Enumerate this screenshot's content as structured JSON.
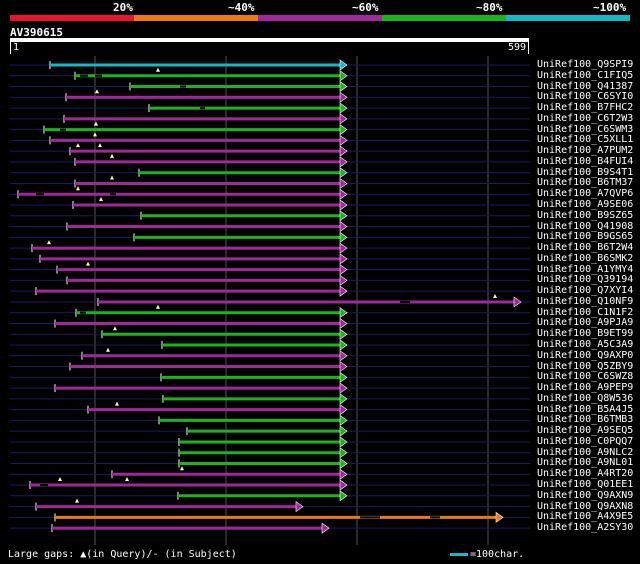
{
  "legend": {
    "segments": [
      {
        "color": "#e8142c"
      },
      {
        "color": "#f07814"
      },
      {
        "color": "#a0289c"
      },
      {
        "color": "#1cb41c"
      },
      {
        "color": "#16b8c8"
      }
    ],
    "labels": [
      "20%",
      "~40%",
      "~60%",
      "~80%",
      "~100%"
    ]
  },
  "query": {
    "name": "AV390615",
    "start": "1",
    "end": "599"
  },
  "hits": [
    {
      "name": "UniRef100_Q9SPI9",
      "color": "#16b8c8",
      "start": 50,
      "end": 347,
      "marks": [],
      "gaps": []
    },
    {
      "name": "UniRef100_C1FIQ5",
      "color": "#1cb41c",
      "start": 75,
      "end": 347,
      "marks": [
        158
      ],
      "gaps": [
        [
          80,
          88
        ],
        [
          95,
          102
        ]
      ]
    },
    {
      "name": "UniRef100_Q41387",
      "color": "#1cb41c",
      "start": 130,
      "end": 347,
      "marks": [],
      "gaps": [
        [
          180,
          186
        ]
      ]
    },
    {
      "name": "UniRef100_C6SYI0",
      "color": "#a0289c",
      "start": 66,
      "end": 347,
      "marks": [
        97
      ],
      "gaps": []
    },
    {
      "name": "UniRef100_B7FHC2",
      "color": "#1cb41c",
      "start": 149,
      "end": 347,
      "marks": [],
      "gaps": [
        [
          200,
          205
        ]
      ]
    },
    {
      "name": "UniRef100_C6T2W3",
      "color": "#a0289c",
      "start": 64,
      "end": 347,
      "marks": [],
      "gaps": []
    },
    {
      "name": "UniRef100_C6SWM3",
      "color": "#1cb41c",
      "start": 44,
      "end": 347,
      "marks": [
        96
      ],
      "gaps": [
        [
          60,
          66
        ]
      ]
    },
    {
      "name": "UniRef100_C5XLL1",
      "color": "#a0289c",
      "start": 50,
      "end": 347,
      "marks": [
        95
      ],
      "gaps": []
    },
    {
      "name": "UniRef100_A7PUM2",
      "color": "#a0289c",
      "start": 70,
      "end": 347,
      "marks": [
        78,
        100
      ],
      "gaps": []
    },
    {
      "name": "UniRef100_B4FUI4",
      "color": "#a0289c",
      "start": 75,
      "end": 347,
      "marks": [
        112
      ],
      "gaps": []
    },
    {
      "name": "UniRef100_B9S4T1",
      "color": "#1cb41c",
      "start": 139,
      "end": 347,
      "marks": [],
      "gaps": []
    },
    {
      "name": "UniRef100_B6TM37",
      "color": "#a0289c",
      "start": 75,
      "end": 347,
      "marks": [
        112
      ],
      "gaps": []
    },
    {
      "name": "UniRef100_A7QVP6",
      "color": "#a0289c",
      "start": 18,
      "end": 347,
      "marks": [
        78
      ],
      "gaps": [
        [
          36,
          44
        ],
        [
          110,
          116
        ]
      ]
    },
    {
      "name": "UniRef100_A9SE06",
      "color": "#a0289c",
      "start": 73,
      "end": 347,
      "marks": [
        101
      ],
      "gaps": []
    },
    {
      "name": "UniRef100_B9SZ65",
      "color": "#1cb41c",
      "start": 141,
      "end": 347,
      "marks": [],
      "gaps": []
    },
    {
      "name": "UniRef100_Q41908",
      "color": "#a0289c",
      "start": 67,
      "end": 347,
      "marks": [],
      "gaps": []
    },
    {
      "name": "UniRef100_B9GS65",
      "color": "#1cb41c",
      "start": 134,
      "end": 347,
      "marks": [],
      "gaps": []
    },
    {
      "name": "UniRef100_B6T2W4",
      "color": "#a0289c",
      "start": 32,
      "end": 347,
      "marks": [
        49
      ],
      "gaps": []
    },
    {
      "name": "UniRef100_B6SMK2",
      "color": "#a0289c",
      "start": 40,
      "end": 347,
      "marks": [],
      "gaps": []
    },
    {
      "name": "UniRef100_A1YMY4",
      "color": "#a0289c",
      "start": 57,
      "end": 347,
      "marks": [
        88
      ],
      "gaps": []
    },
    {
      "name": "UniRef100_Q39194",
      "color": "#a0289c",
      "start": 67,
      "end": 347,
      "marks": [],
      "gaps": []
    },
    {
      "name": "UniRef100_Q7XYI4",
      "color": "#a0289c",
      "start": 36,
      "end": 347,
      "marks": [],
      "gaps": []
    },
    {
      "name": "UniRef100_Q10NF9",
      "color": "#a0289c",
      "start": 98,
      "end": 521,
      "marks": [
        495
      ],
      "gaps": [
        [
          400,
          410
        ]
      ]
    },
    {
      "name": "UniRef100_C1N1F2",
      "color": "#1cb41c",
      "start": 76,
      "end": 347,
      "marks": [
        158
      ],
      "gaps": [
        [
          80,
          86
        ]
      ]
    },
    {
      "name": "UniRef100_A9PJA9",
      "color": "#a0289c",
      "start": 55,
      "end": 347,
      "marks": [],
      "gaps": []
    },
    {
      "name": "UniRef100_B9ET99",
      "color": "#1cb41c",
      "start": 102,
      "end": 347,
      "marks": [
        115
      ],
      "gaps": []
    },
    {
      "name": "UniRef100_A5C3A9",
      "color": "#1cb41c",
      "start": 162,
      "end": 347,
      "marks": [],
      "gaps": []
    },
    {
      "name": "UniRef100_Q9AXP0",
      "color": "#a0289c",
      "start": 82,
      "end": 347,
      "marks": [
        108
      ],
      "gaps": []
    },
    {
      "name": "UniRef100_Q5ZBY9",
      "color": "#a0289c",
      "start": 70,
      "end": 347,
      "marks": [],
      "gaps": []
    },
    {
      "name": "UniRef100_C6SWZ8",
      "color": "#1cb41c",
      "start": 161,
      "end": 347,
      "marks": [],
      "gaps": []
    },
    {
      "name": "UniRef100_A9PEP9",
      "color": "#a0289c",
      "start": 55,
      "end": 347,
      "marks": [],
      "gaps": []
    },
    {
      "name": "UniRef100_Q8W536",
      "color": "#1cb41c",
      "start": 163,
      "end": 347,
      "marks": [],
      "gaps": []
    },
    {
      "name": "UniRef100_B5A4J5",
      "color": "#a0289c",
      "start": 88,
      "end": 347,
      "marks": [
        117
      ],
      "gaps": []
    },
    {
      "name": "UniRef100_B6TMB3",
      "color": "#1cb41c",
      "start": 159,
      "end": 347,
      "marks": [],
      "gaps": []
    },
    {
      "name": "UniRef100_A9SEQ5",
      "color": "#1cb41c",
      "start": 187,
      "end": 347,
      "marks": [],
      "gaps": []
    },
    {
      "name": "UniRef100_C0PQQ7",
      "color": "#1cb41c",
      "start": 179,
      "end": 347,
      "marks": [],
      "gaps": []
    },
    {
      "name": "UniRef100_A9NLC2",
      "color": "#1cb41c",
      "start": 179,
      "end": 347,
      "marks": [],
      "gaps": []
    },
    {
      "name": "UniRef100_A9NL01",
      "color": "#1cb41c",
      "start": 179,
      "end": 347,
      "marks": [],
      "gaps": []
    },
    {
      "name": "UniRef100_A4RT20",
      "color": "#a0289c",
      "start": 112,
      "end": 347,
      "marks": [
        182
      ],
      "gaps": []
    },
    {
      "name": "UniRef100_Q01EE1",
      "color": "#a0289c",
      "start": 30,
      "end": 347,
      "marks": [
        60,
        127
      ],
      "gaps": [
        [
          40,
          48
        ]
      ]
    },
    {
      "name": "UniRef100_Q9AXN9",
      "color": "#1cb41c",
      "start": 178,
      "end": 347,
      "marks": [],
      "gaps": []
    },
    {
      "name": "UniRef100_Q9AXN8",
      "color": "#a0289c",
      "start": 36,
      "end": 303,
      "marks": [
        77
      ],
      "gaps": []
    },
    {
      "name": "UniRef100_A4X9E5",
      "color": "#f07814",
      "start": 55,
      "end": 503,
      "marks": [],
      "gaps": [
        [
          360,
          380
        ],
        [
          430,
          440
        ]
      ]
    },
    {
      "name": "UniRef100_A2SY30",
      "color": "#a0289c",
      "start": 52,
      "end": 329,
      "marks": [],
      "gaps": []
    }
  ],
  "footer": {
    "gap_text": "Large gaps: ▲(in Query)/- (in Subject)",
    "scale_text": "=100char."
  }
}
